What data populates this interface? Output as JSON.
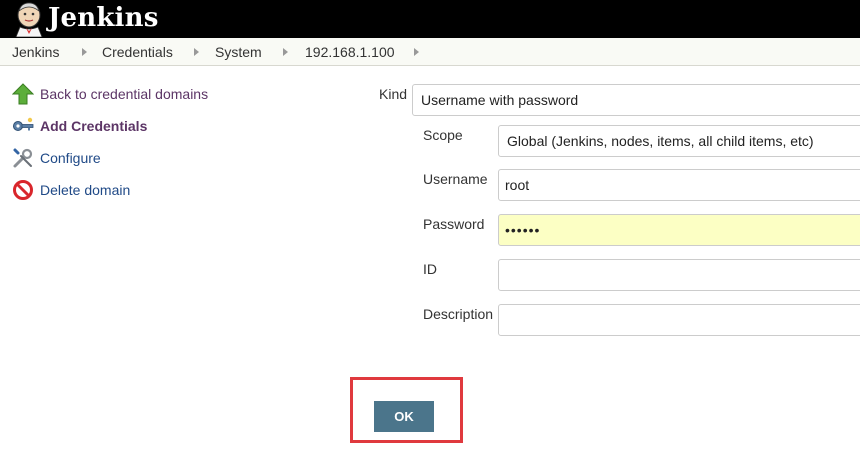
{
  "header": {
    "brand": "Jenkins",
    "logo_icon": "jenkins-butler-icon"
  },
  "breadcrumb": {
    "items": [
      "Jenkins",
      "Credentials",
      "System",
      "192.168.1.100"
    ]
  },
  "sidebar": {
    "items": [
      {
        "label": "Back to credential domains",
        "icon": "green-up-arrow-icon"
      },
      {
        "label": "Add Credentials",
        "icon": "key-icon"
      },
      {
        "label": "Configure",
        "icon": "wrench-screwdriver-icon"
      },
      {
        "label": "Delete domain",
        "icon": "no-entry-icon"
      }
    ]
  },
  "form": {
    "kind_label": "Kind",
    "kind_value": "Username with password",
    "scope_label": "Scope",
    "scope_value": "Global (Jenkins, nodes, items, all child items, etc)",
    "username_label": "Username",
    "username_value": "root",
    "password_label": "Password",
    "password_value": "••••••",
    "id_label": "ID",
    "id_value": "",
    "description_label": "Description",
    "description_value": "",
    "ok_label": "OK"
  },
  "colors": {
    "header_bg": "#000000",
    "link": "#204a87",
    "visited_link": "#5c3566",
    "password_bg": "#fcffc4",
    "ok_button": "#4b758b",
    "highlight": "#e0393e"
  }
}
